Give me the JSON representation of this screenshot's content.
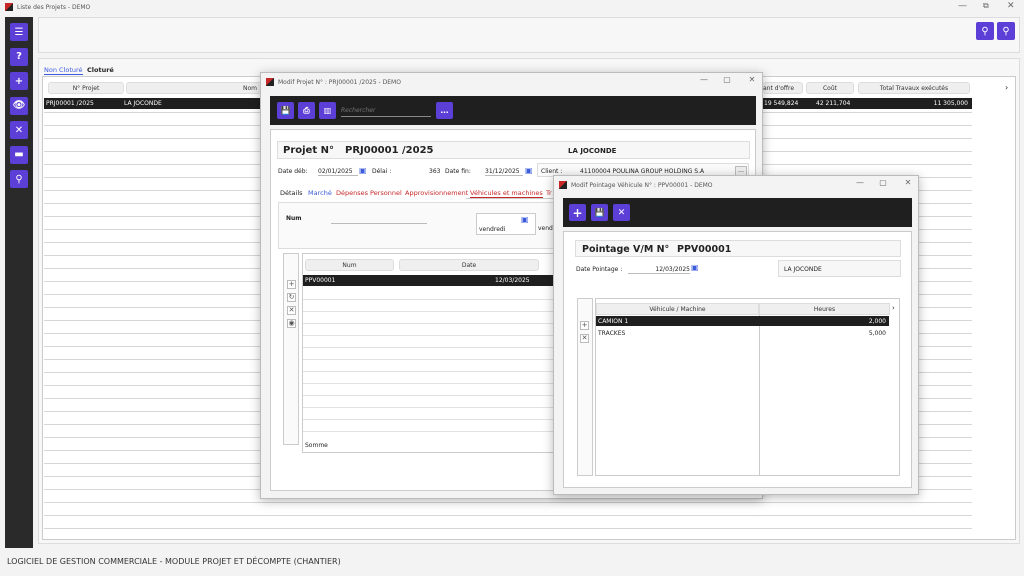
{
  "app": {
    "title": "Liste des Projets - DEMO",
    "footer": "LOGICIEL DE GESTION COMMERCIALE - MODULE PROJET ET DÉCOMPTE (CHANTIER)"
  },
  "sidebar": {
    "buttons": [
      {
        "name": "menu",
        "glyph": "☰"
      },
      {
        "name": "help",
        "glyph": "?"
      },
      {
        "name": "add",
        "glyph": "+"
      },
      {
        "name": "view",
        "glyph": "👁"
      },
      {
        "name": "delete",
        "glyph": "✕"
      },
      {
        "name": "card",
        "glyph": "▬"
      },
      {
        "name": "search-user",
        "glyph": "⚲"
      }
    ]
  },
  "main": {
    "tabs": [
      {
        "label": "Non Cloturé"
      },
      {
        "label": "Cloturé"
      }
    ],
    "headers": [
      "N° Projet",
      "Nom"
    ],
    "headers_right": [
      "ant d'offre",
      "Coût",
      "Total Travaux exécutés"
    ],
    "row": {
      "num": "PRJ00001 /2025",
      "name": "LA JOCONDE",
      "offre": "19 549,824",
      "cout": "42 211,704",
      "travaux": "11 305,000"
    }
  },
  "projet": {
    "window_title": "Modif  Projet N° : PRJ00001 /2025 - DEMO",
    "search_placeholder": "Rechercher",
    "heading_label": "Projet N°",
    "heading_value": "PRJ00001 /2025",
    "heading_name": "LA JOCONDE",
    "date_deb_label": "Date déb:",
    "date_deb": "02/01/2025",
    "delai_label": "Délai :",
    "delai": "363",
    "date_fin_label": "Date fin:",
    "date_fin": "31/12/2025",
    "client_label": "Client :",
    "client": "41100004   POULINA GROUP HOLDING S.A",
    "tabs": [
      "Détails",
      "Marché",
      "Dépenses",
      "Personnel",
      "Approvisionnement",
      "Véhicules et machines",
      "Tr"
    ],
    "num_label": "Num",
    "day_value": "vendredi",
    "day_value2": "vend",
    "grid_headers": [
      "Num",
      "Date"
    ],
    "grid_row": {
      "num": "PPV00001",
      "date": "12/03/2025"
    },
    "somme": "Somme"
  },
  "pointage": {
    "window_title": "Modif  Pointage Véhicule N° : PPV00001 - DEMO",
    "heading_label": "Pointage V/M N°",
    "heading_value": "PPV00001",
    "date_label": "Date Pointage :",
    "date": "12/03/2025",
    "projet_name": "LA JOCONDE",
    "grid_headers": [
      "Véhicule / Machine",
      "Heures"
    ],
    "rows": [
      {
        "name": "CAMION 1",
        "hours": "2,000"
      },
      {
        "name": "TRACKES",
        "hours": "5,000"
      }
    ]
  },
  "colors": {
    "accent": "#5b3fd6",
    "selection": "#1f1f1f",
    "tab_active": "#3b5bdb",
    "tab_red": "#c62828"
  }
}
